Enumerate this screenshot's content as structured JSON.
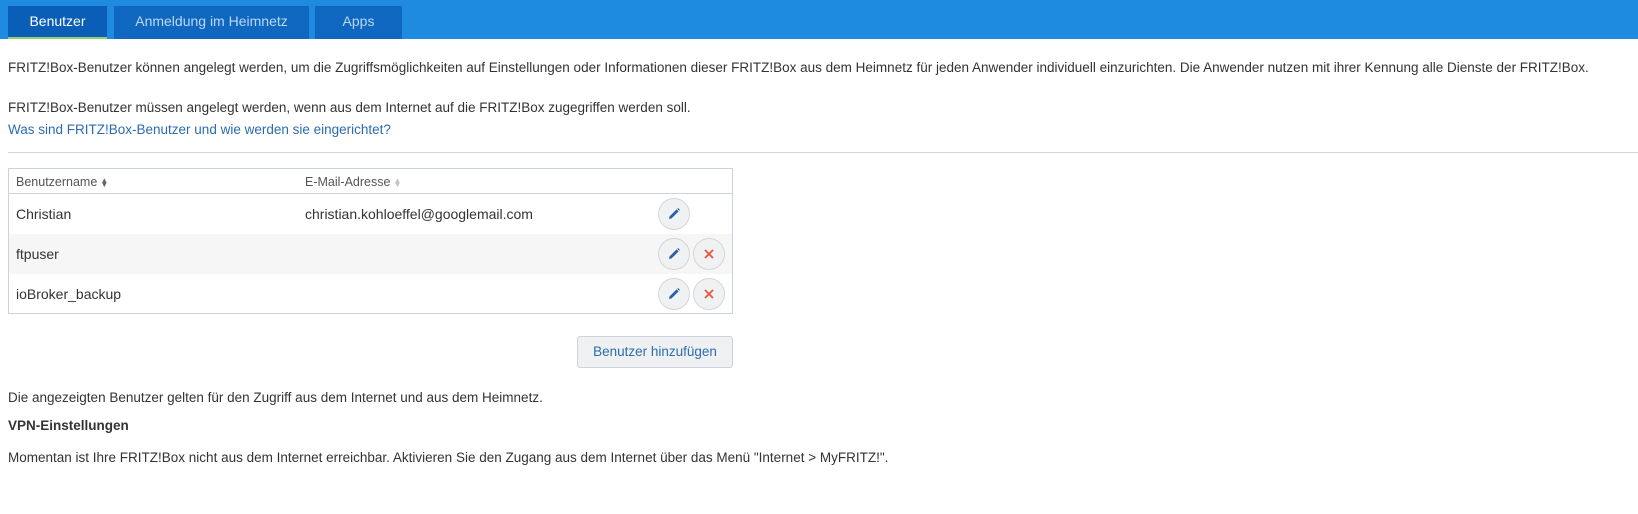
{
  "tabs": [
    {
      "label": "Benutzer",
      "active": true
    },
    {
      "label": "Anmeldung im Heimnetz",
      "active": false
    },
    {
      "label": "Apps",
      "active": false
    }
  ],
  "intro": {
    "paragraph1": "FRITZ!Box-Benutzer können angelegt werden, um die Zugriffsmöglichkeiten auf Einstellungen oder Informationen dieser FRITZ!Box aus dem Heimnetz für jeden Anwender individuell einzurichten. Die Anwender nutzen mit ihrer Kennung alle Dienste der FRITZ!Box.",
    "paragraph2": "FRITZ!Box-Benutzer müssen angelegt werden, wenn aus dem Internet auf die FRITZ!Box zugegriffen werden soll.",
    "help_link": "Was sind FRITZ!Box-Benutzer und wie werden sie eingerichtet?"
  },
  "table": {
    "columns": {
      "name": "Benutzername",
      "email": "E-Mail-Adresse"
    },
    "rows": [
      {
        "name": "Christian",
        "email": "christian.kohloeffel@googlemail.com",
        "deletable": false
      },
      {
        "name": "ftpuser",
        "email": "",
        "deletable": true
      },
      {
        "name": "ioBroker_backup",
        "email": "",
        "deletable": true
      }
    ]
  },
  "actions": {
    "add_user_label": "Benutzer hinzufügen"
  },
  "footer": {
    "note": "Die angezeigten Benutzer gelten für den Zugriff aus dem Internet und aus dem Heimnetz.",
    "vpn_heading": "VPN-Einstellungen",
    "vpn_text": "Momentan ist Ihre FRITZ!Box nicht aus dem Internet erreichbar. Aktivieren Sie den Zugang aus dem Internet über das Menü \"Internet > MyFRITZ!\"."
  },
  "colors": {
    "tabbar": "#1e8ae0",
    "tab": "#0f67c0",
    "active_underline": "#8fd16a",
    "link": "#2b6cb0",
    "edit_icon": "#2b5ea8",
    "delete_icon": "#e8553e"
  },
  "icons": {
    "edit": "pencil-icon",
    "delete": "close-icon"
  }
}
